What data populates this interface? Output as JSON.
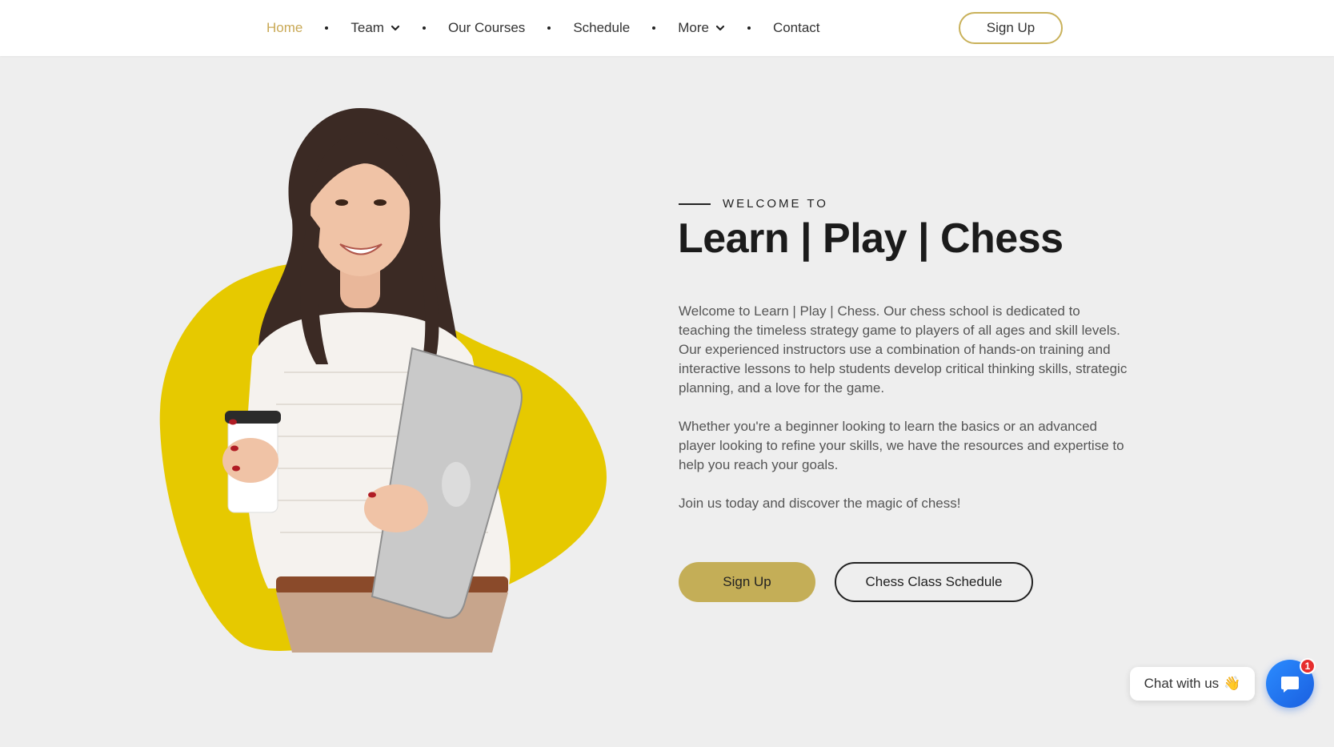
{
  "nav": {
    "items": [
      {
        "label": "Home",
        "active": true,
        "dropdown": false
      },
      {
        "label": "Team",
        "active": false,
        "dropdown": true
      },
      {
        "label": "Our Courses",
        "active": false,
        "dropdown": false
      },
      {
        "label": "Schedule",
        "active": false,
        "dropdown": false
      },
      {
        "label": "More",
        "active": false,
        "dropdown": true
      },
      {
        "label": "Contact",
        "active": false,
        "dropdown": false
      }
    ],
    "signup_label": "Sign Up"
  },
  "hero": {
    "eyebrow": "WELCOME TO",
    "title": "Learn | Play | Chess",
    "paragraphs": [
      "Welcome to Learn | Play | Chess. Our chess school is dedicated to teaching the timeless strategy game to players of all ages and skill levels. Our experienced instructors use a combination of hands-on training and interactive lessons to help students develop critical thinking skills, strategic planning, and a love for the game.",
      "Whether you're a beginner looking to learn the basics or an advanced player looking to refine your skills, we have the resources and expertise to help you reach your goals.",
      "Join us today and discover the magic of chess!"
    ],
    "primary_button": "Sign Up",
    "secondary_button": "Chess Class Schedule"
  },
  "chat": {
    "label": "Chat with us",
    "emoji": "👋",
    "badge_count": "1"
  },
  "colors": {
    "accent_gold": "#c9a956",
    "button_gold": "#c4ae57",
    "blob_yellow": "#e6c900",
    "chat_blue": "#1f6fee",
    "badge_red": "#e62e2e"
  },
  "icons": [
    "chevron-down-icon",
    "chat-icon",
    "wave-hand-icon"
  ]
}
